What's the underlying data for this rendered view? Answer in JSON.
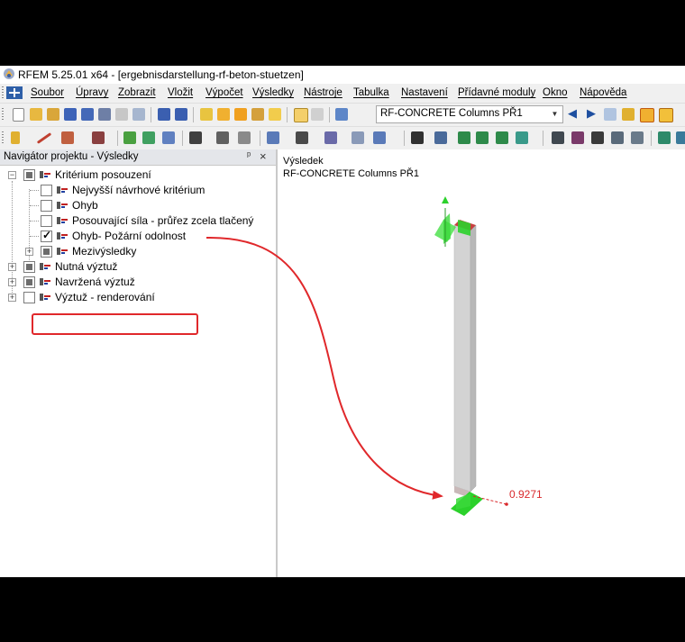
{
  "window": {
    "title": "RFEM 5.25.01 x64 - [ergebnisdarstellung-rf-beton-stuetzen]"
  },
  "menu": {
    "items": [
      "Soubor",
      "Úpravy",
      "Zobrazit",
      "Vložit",
      "Výpočet",
      "Výsledky",
      "Nástroje",
      "Tabulka",
      "Nastavení",
      "Přídavné moduly",
      "Okno",
      "Nápověda"
    ]
  },
  "toolbar1": {
    "module_select": "RF-CONCRETE Columns PŘ1"
  },
  "navigator": {
    "title": "Navigátor projektu - Výsledky",
    "pin": "ᵖ",
    "close": "×",
    "tree": [
      {
        "label": "Kritérium posouzení",
        "state": "partial",
        "expanded": true
      },
      {
        "label": "Nejvyšší návrhové kritérium",
        "state": "unchecked"
      },
      {
        "label": "Ohyb",
        "state": "unchecked"
      },
      {
        "label": "Posouvající síla - průřez zcela tlačený",
        "state": "unchecked"
      },
      {
        "label": "Ohyb- Požární odolnost",
        "state": "checked"
      },
      {
        "label": "Mezivýsledky",
        "state": "partial",
        "expanded": false
      },
      {
        "label": "Nutná výztuž",
        "state": "partial",
        "expanded": false
      },
      {
        "label": "Navržená výztuž",
        "state": "partial",
        "expanded": false
      },
      {
        "label": "Výztuž - renderování",
        "state": "unchecked",
        "expanded": false
      }
    ]
  },
  "viewport": {
    "line1": "Výsledek",
    "line2": "RF-CONCRETE Columns PŘ1",
    "result_value": "0.9271"
  },
  "colors": {
    "highlight": "#e0282b",
    "support": "#2bd12b",
    "column_front": "#d3d3d3",
    "column_side": "#b8b8b8"
  }
}
